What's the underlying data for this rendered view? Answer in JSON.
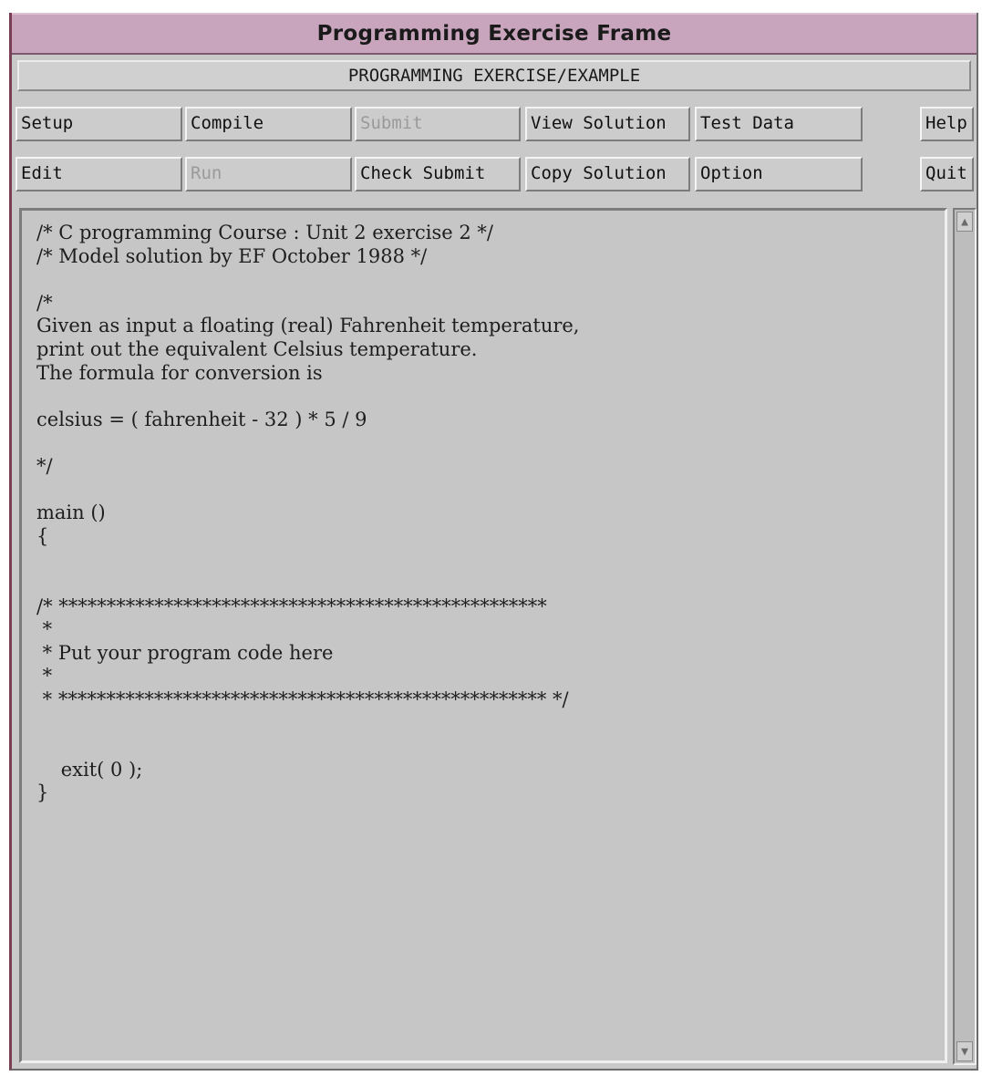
{
  "window": {
    "title": "Programming Exercise Frame",
    "subheader": "PROGRAMMING EXERCISE/EXAMPLE"
  },
  "toolbar": {
    "row1": {
      "setup": "Setup",
      "compile": "Compile",
      "submit": "Submit",
      "view_solution": "View Solution",
      "test_data": "Test Data",
      "help": "Help"
    },
    "row2": {
      "edit": "Edit",
      "run": "Run",
      "check_submit": "Check Submit",
      "copy_solution": "Copy Solution",
      "option": "Option",
      "quit": "Quit"
    },
    "disabled_buttons": [
      "Submit",
      "Run"
    ]
  },
  "editor": {
    "code": "/* C programming Course : Unit 2 exercise 2 */\n/* Model solution by EF October 1988 */\n\n/*\nGiven as input a floating (real) Fahrenheit temperature,\nprint out the equivalent Celsius temperature.\nThe formula for conversion is\n\ncelsius = ( fahrenheit - 32 ) * 5 / 9\n\n*/\n\nmain ()\n{\n\n\n/* ***************************************************\n *\n * Put your program code here\n *\n * *************************************************** */\n\n\n    exit( 0 );\n}"
  },
  "scrollbar": {
    "up_icon": "arrow-up-icon",
    "down_icon": "arrow-down-icon"
  },
  "colors": {
    "titlebar": "#c8a4bd",
    "window_bg": "#c9c9c9",
    "disabled_text": "#9a9a9a"
  }
}
